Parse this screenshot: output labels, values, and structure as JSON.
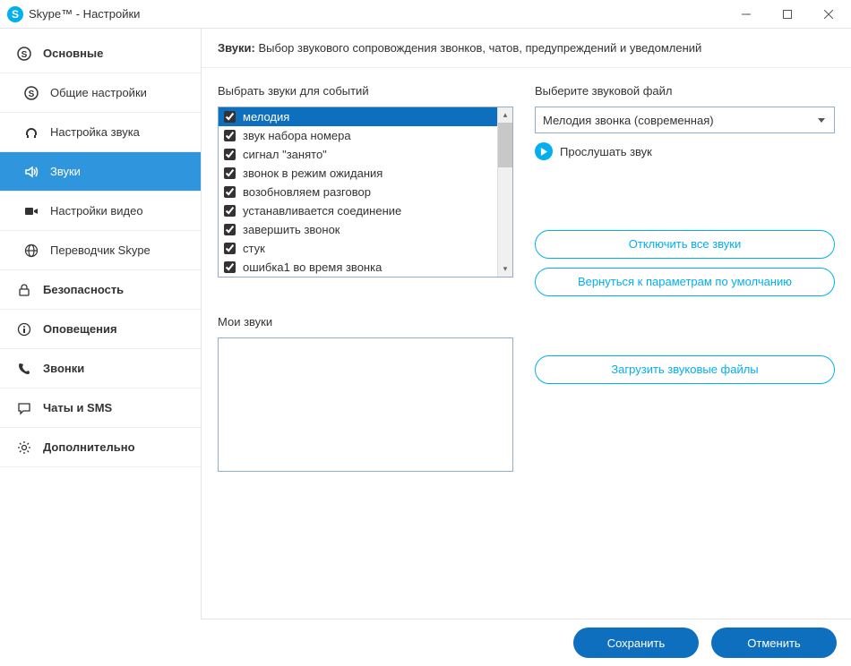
{
  "titlebar": {
    "title": "Skype™ - Настройки"
  },
  "sidebar": {
    "items": [
      {
        "label": "Основные",
        "icon": "skype"
      },
      {
        "label": "Общие настройки",
        "icon": "skype",
        "sub": true
      },
      {
        "label": "Настройка звука",
        "icon": "headset",
        "sub": true
      },
      {
        "label": "Звуки",
        "icon": "speaker",
        "sub": true,
        "active": true
      },
      {
        "label": "Настройки видео",
        "icon": "video",
        "sub": true
      },
      {
        "label": "Переводчик Skype",
        "icon": "globe",
        "sub": true
      },
      {
        "label": "Безопасность",
        "icon": "lock"
      },
      {
        "label": "Оповещения",
        "icon": "info"
      },
      {
        "label": "Звонки",
        "icon": "phone"
      },
      {
        "label": "Чаты и SMS",
        "icon": "chat"
      },
      {
        "label": "Дополнительно",
        "icon": "gear"
      }
    ]
  },
  "main": {
    "header_bold": "Звуки:",
    "header_text": " Выбор звукового сопровождения звонков, чатов, предупреждений и уведомлений",
    "events_label": "Выбрать звуки для событий",
    "soundfile_label": "Выберите звуковой файл",
    "selected_sound": "Мелодия звонка (современная)",
    "play_label": "Прослушать звук",
    "disable_all_btn": "Отключить все звуки",
    "reset_btn": "Вернуться к параметрам по умолчанию",
    "my_sounds_label": "Мои звуки",
    "upload_btn": "Загрузить звуковые файлы",
    "events": [
      {
        "label": "мелодия",
        "checked": true,
        "selected": true
      },
      {
        "label": "звук набора номера",
        "checked": true
      },
      {
        "label": "сигнал \"занято\"",
        "checked": true
      },
      {
        "label": "звонок в режим ожидания",
        "checked": true
      },
      {
        "label": "возобновляем разговор",
        "checked": true
      },
      {
        "label": "устанавливается соединение",
        "checked": true
      },
      {
        "label": "завершить звонок",
        "checked": true
      },
      {
        "label": "стук",
        "checked": true
      },
      {
        "label": "ошибка1 во время звонка",
        "checked": true
      }
    ]
  },
  "footer": {
    "save": "Сохранить",
    "cancel": "Отменить"
  }
}
